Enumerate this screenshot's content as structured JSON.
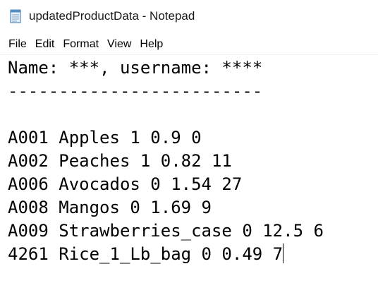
{
  "window": {
    "title": "updatedProductData - Notepad",
    "icon": "notepad-icon"
  },
  "menu": {
    "items": [
      "File",
      "Edit",
      "Format",
      "View",
      "Help"
    ]
  },
  "editor": {
    "lines": [
      "Name: ***, username: ****",
      "-------------------------",
      "",
      "A001 Apples 1 0.9 0",
      "A002 Peaches 1 0.82 11",
      "A006 Avocados 0 1.54 27",
      "A008 Mangos 0 1.69 9",
      "A009 Strawberries_case 0 12.5 6",
      "4261 Rice_1_Lb_bag 0 0.49 7"
    ]
  }
}
